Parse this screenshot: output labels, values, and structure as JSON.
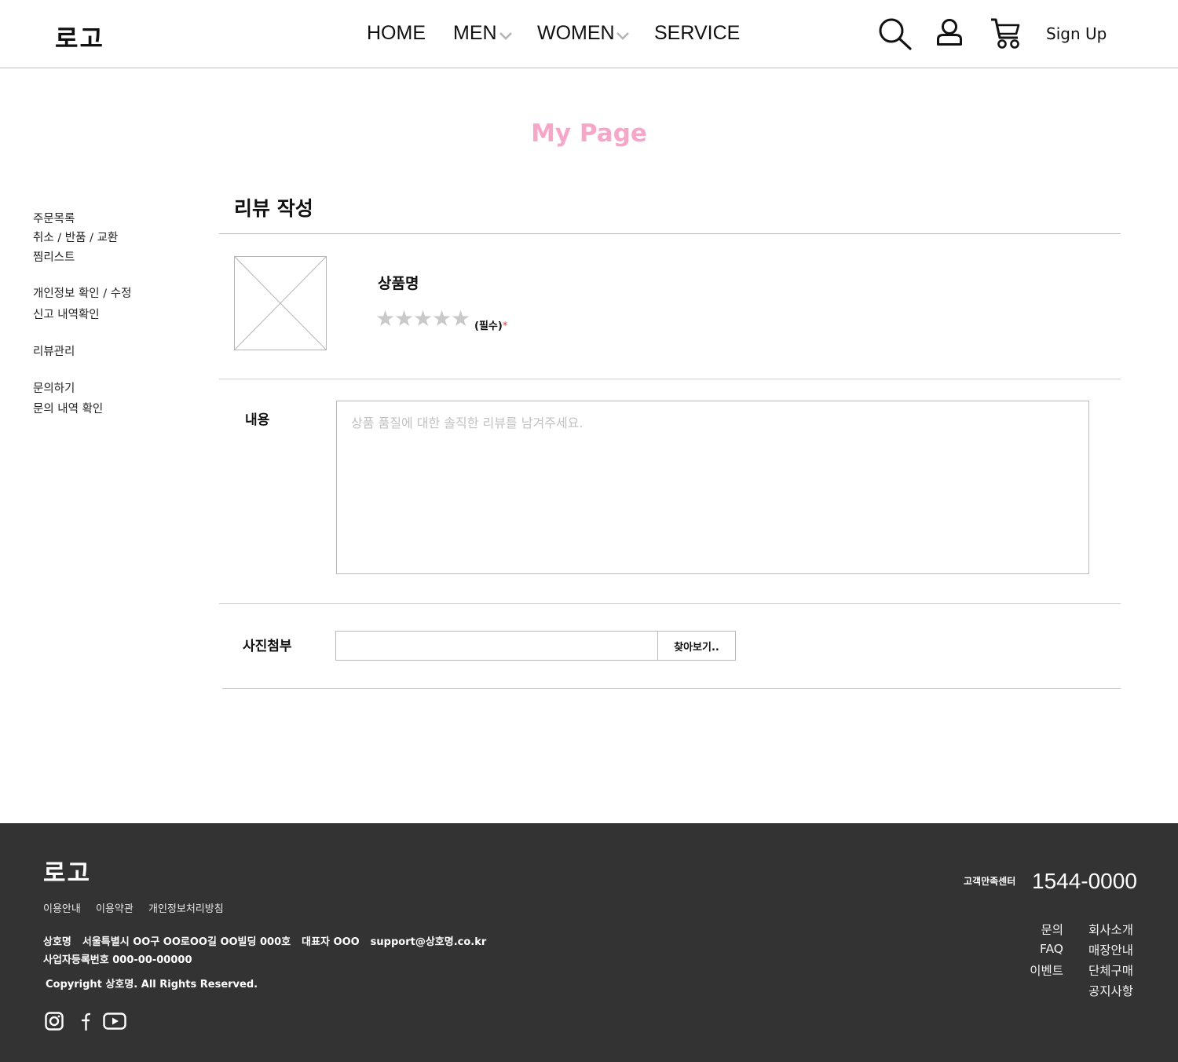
{
  "header": {
    "logo": "로고",
    "nav": [
      {
        "label": "HOME"
      },
      {
        "label": "MEN"
      },
      {
        "label": "WOMEN"
      },
      {
        "label": "SERVICE"
      }
    ],
    "signup_label": "Sign Up"
  },
  "page_title": "My Page",
  "sidebar": {
    "items": [
      "주문목록",
      "취소 / 반품 / 교환",
      "찜리스트",
      "개인정보 확인 / 수정",
      "신고 내역확인",
      "리뷰관리",
      "문의하기",
      "문의 내역 확인"
    ]
  },
  "review": {
    "section_title": "리뷰 작성",
    "product_name": "상품명",
    "stars": [
      "★",
      "★",
      "★",
      "★",
      "★"
    ],
    "rating_filled": 0,
    "required_label": "(필수)",
    "required_mark": "*",
    "content_label": "내용",
    "content_placeholder": "상품 품질에 대한 솔직한 리뷰를 남겨주세요.",
    "photo_label": "사진첨부",
    "browse_label": "찾아보기.."
  },
  "footer": {
    "logo": "로고",
    "links": [
      "이용안내",
      "이용약관",
      "개인정보처리방침"
    ],
    "company": [
      "상호명",
      "서울특별시 OO구 OO로OO길 OO빌딩 000호",
      "대표자 OOO",
      "support@상호명.co.kr"
    ],
    "business_no": "사업자등록번호 000-00-00000",
    "copyright": "Copyright 상호명. All Rights Reserved.",
    "cs_label": "고객만족센터",
    "cs_phone": "1544-0000",
    "menu_left": [
      "문의",
      "FAQ",
      "이벤트"
    ],
    "menu_right": [
      "회사소개",
      "매장안내",
      "단체구매",
      "공지사항"
    ],
    "social": [
      "instagram-icon",
      "facebook-icon",
      "youtube-icon"
    ]
  },
  "colors": {
    "title_pink": "#f6a6c9",
    "footer_bg": "#333333",
    "star_gray": "#c9c9c9",
    "required_red": "#e23b3b"
  }
}
